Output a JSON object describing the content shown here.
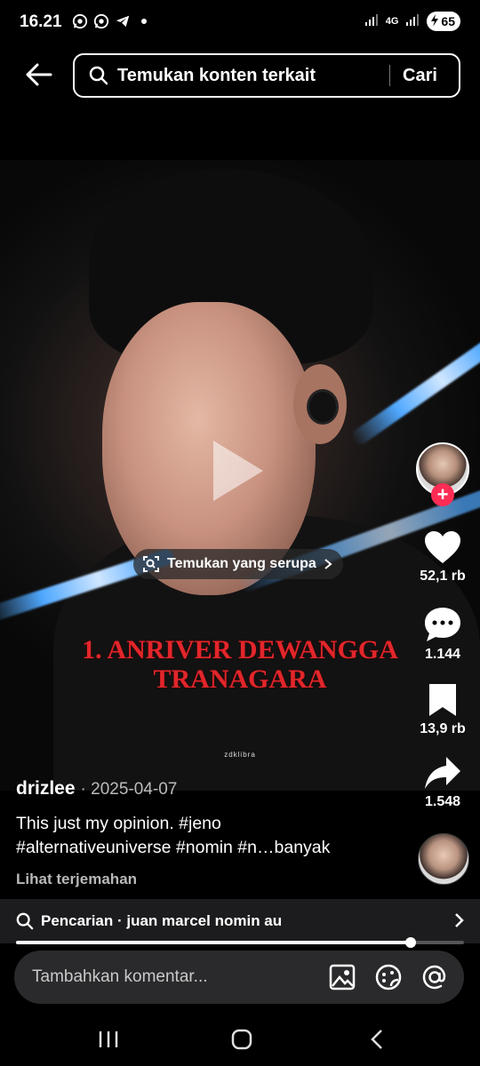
{
  "status_bar": {
    "time": "16.21",
    "network": "4G",
    "battery": "65"
  },
  "search": {
    "placeholder": "Temukan konten terkait",
    "submit_label": "Cari"
  },
  "video": {
    "find_similar_label": "Temukan yang serupa",
    "overlay_title_line1": "1. ANRIVER DEWANGGA",
    "overlay_title_line2": "TRANAGARA",
    "watermark": "zdklibra"
  },
  "actions": {
    "likes": "52,1 rb",
    "comments": "1.144",
    "saves": "13,9 rb",
    "shares": "1.548"
  },
  "post": {
    "username": "drizlee",
    "date": "· 2025-04-07",
    "caption_line1": "This just my opinion. #jeno",
    "caption_line2": "#alternativeuniverse #nomin #n…banyak",
    "translate_label": "Lihat terjemahan"
  },
  "related_search": {
    "label": "Pencarian · juan marcel nomin au"
  },
  "playback": {
    "progress_fraction": 0.88
  },
  "comment_bar": {
    "placeholder": "Tambahkan komentar..."
  },
  "colors": {
    "accent_follow": "#fe2c55",
    "overlay_title": "#e2262b"
  }
}
